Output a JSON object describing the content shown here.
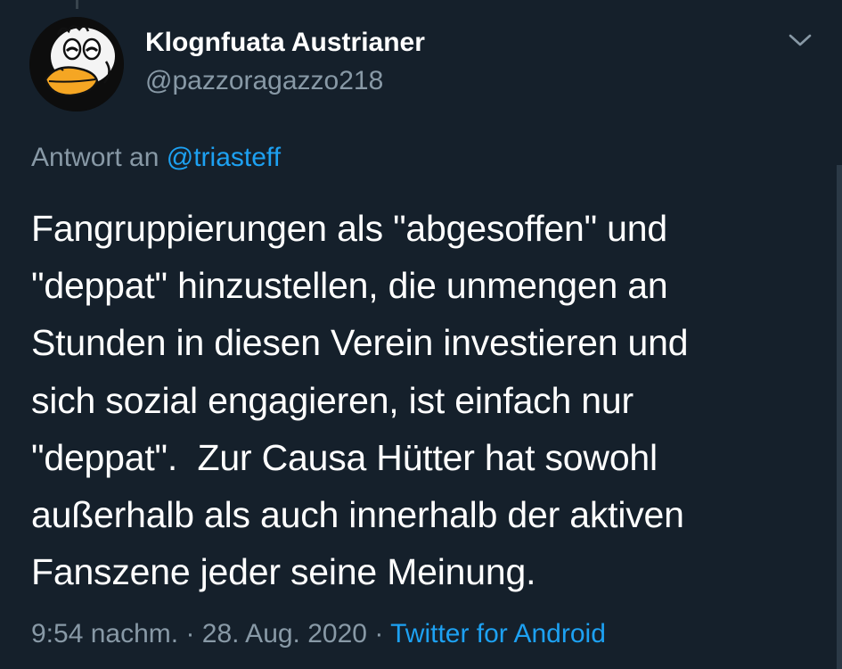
{
  "tweet": {
    "author": {
      "display_name": "Klognfuata Austrianer",
      "handle": "@pazzoragazzo218",
      "avatar_icon": "donald-duck-avatar"
    },
    "reply_to": {
      "prefix": "Antwort an",
      "mention": "@triasteff"
    },
    "text_lines": [
      "Fangruppierungen als \"abgesoffen\" und",
      "\"deppat\" hinzustellen, die unmengen an",
      "Stunden in diesen Verein investieren und",
      "sich sozial engagieren, ist einfach nur",
      "\"deppat\".  Zur Causa Hütter hat sowohl",
      "außerhalb als auch innerhalb der aktiven",
      "Fanszene jeder seine Meinung."
    ],
    "meta": {
      "time": "9:54 nachm.",
      "separator": "·",
      "date": "28. Aug. 2020",
      "source": "Twitter for Android"
    },
    "menu_icon": "chevron-down-icon"
  },
  "colors": {
    "background": "#15202b",
    "primary_text": "#ffffff",
    "secondary_text": "#8899a6",
    "accent": "#1da1f2"
  }
}
